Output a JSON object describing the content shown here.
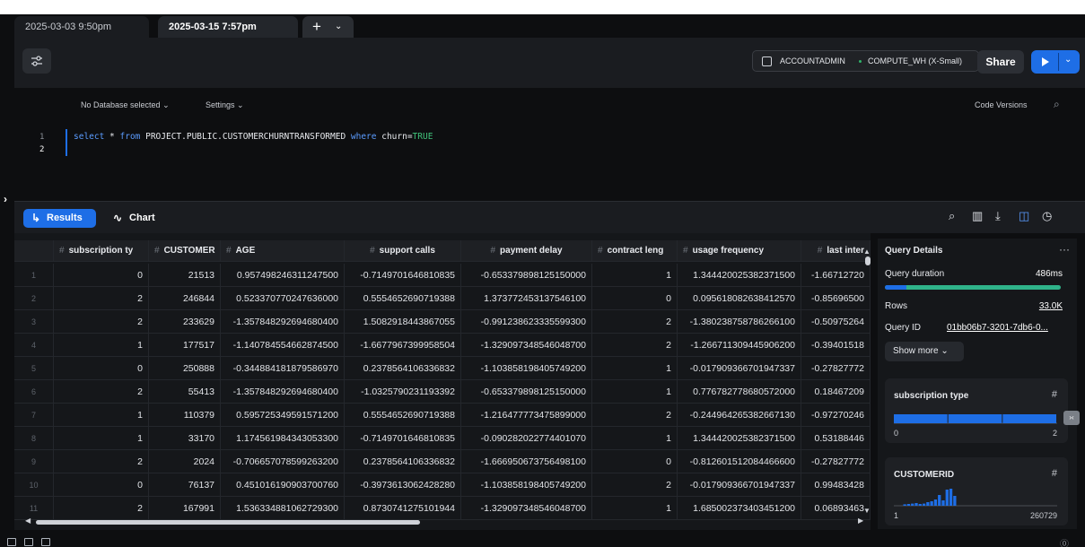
{
  "tabs": [
    {
      "label": "2025-03-03 9:50pm",
      "active": false
    },
    {
      "label": "2025-03-15 7:57pm",
      "active": true
    }
  ],
  "tab_actions": {
    "add": "+",
    "menu": "⌄"
  },
  "toolbar": {
    "role": "ACCOUNTADMIN",
    "warehouse": "COMPUTE_WH (X-Small)",
    "share_label": "Share",
    "accent": "#1e6ee6"
  },
  "editor": {
    "database_label": "No Database selected",
    "settings_label": "Settings",
    "code_versions_label": "Code Versions",
    "line_numbers": [
      "1",
      "2"
    ],
    "code": {
      "select": "select",
      "star": " * ",
      "from": "from",
      "table": " PROJECT.PUBLIC.CUSTOMERCHURNTRANSFORMED ",
      "where": "where",
      "col": " churn=",
      "value": "TRUE"
    }
  },
  "results": {
    "results_label": "Results",
    "chart_label": "Chart"
  },
  "grid": {
    "columns": [
      "subscription ty",
      "CUSTOMER",
      "AGE",
      "support calls",
      "payment delay",
      "contract leng",
      "usage frequency",
      "last inter"
    ],
    "rows": [
      [
        "1",
        "0",
        "21513",
        "0.957498246311247500",
        "-0.7149701646810835",
        "-0.653379898125150000",
        "1",
        "1.344420025382371500",
        "-1.66712720"
      ],
      [
        "2",
        "2",
        "246844",
        "0.523370770247636000",
        "0.5554652690719388",
        "1.373772453137546100",
        "0",
        "0.095618082638412570",
        "-0.85696500"
      ],
      [
        "3",
        "2",
        "233629",
        "-1.357848292694680400",
        "1.5082918443867055",
        "-0.991238623335599300",
        "2",
        "-1.380238758786266100",
        "-0.50975264"
      ],
      [
        "4",
        "1",
        "177517",
        "-1.140784554662874500",
        "-1.6677967399958504",
        "-1.329097348546048700",
        "2",
        "-1.266711309445906200",
        "-0.39401518"
      ],
      [
        "5",
        "0",
        "250888",
        "-0.344884181879586970",
        "0.2378564106336832",
        "-1.103858198405749200",
        "1",
        "-0.017909366701947337",
        "-0.27827772"
      ],
      [
        "6",
        "2",
        "55413",
        "-1.357848292694680400",
        "-1.0325790231193392",
        "-0.653379898125150000",
        "1",
        "0.776782778680572000",
        "0.18467209"
      ],
      [
        "7",
        "1",
        "110379",
        "0.595725349591571200",
        "0.5554652690719388",
        "-1.216477773475899000",
        "2",
        "-0.244964265382667130",
        "-0.97270246"
      ],
      [
        "8",
        "1",
        "33170",
        "1.174561984343053300",
        "-0.7149701646810835",
        "-0.090282022774401070",
        "1",
        "1.344420025382371500",
        "0.53188446"
      ],
      [
        "9",
        "2",
        "2024",
        "-0.706657078599263200",
        "0.2378564106336832",
        "-1.666950673756498100",
        "0",
        "-0.812601512084466600",
        "-0.27827772"
      ],
      [
        "10",
        "0",
        "76137",
        "0.451016190903700760",
        "-0.3973613062428280",
        "-1.103858198405749200",
        "2",
        "-0.017909366701947337",
        "0.99483428"
      ],
      [
        "11",
        "2",
        "167991",
        "1.536334881062729300",
        "0.8730741275101944",
        "-1.329097348546048700",
        "1",
        "1.685002373403451200",
        "0.06893463"
      ]
    ]
  },
  "query_details": {
    "title": "Query Details",
    "more": "···",
    "duration_label": "Query duration",
    "duration_value": "486ms",
    "duration_compile_fraction": 0.12,
    "rows_label": "Rows",
    "rows_value": "33.0K",
    "query_id_label": "Query ID",
    "query_id_value": "01bb06b7-3201-7db6-0...",
    "show_more_label": "Show more"
  },
  "column_stats": [
    {
      "name": "subscription type",
      "type_icon": "#",
      "min": "0",
      "max": "2",
      "distribution": [
        0.5,
        0.5,
        0.5
      ]
    },
    {
      "name": "CUSTOMERID",
      "type_icon": "#",
      "min": "1",
      "max": "260729",
      "distribution": [
        0.08,
        0.1,
        0.12,
        0.15,
        0.1,
        0.12,
        0.2,
        0.25,
        0.35,
        0.6,
        0.3,
        0.9,
        0.95,
        0.55
      ]
    }
  ]
}
